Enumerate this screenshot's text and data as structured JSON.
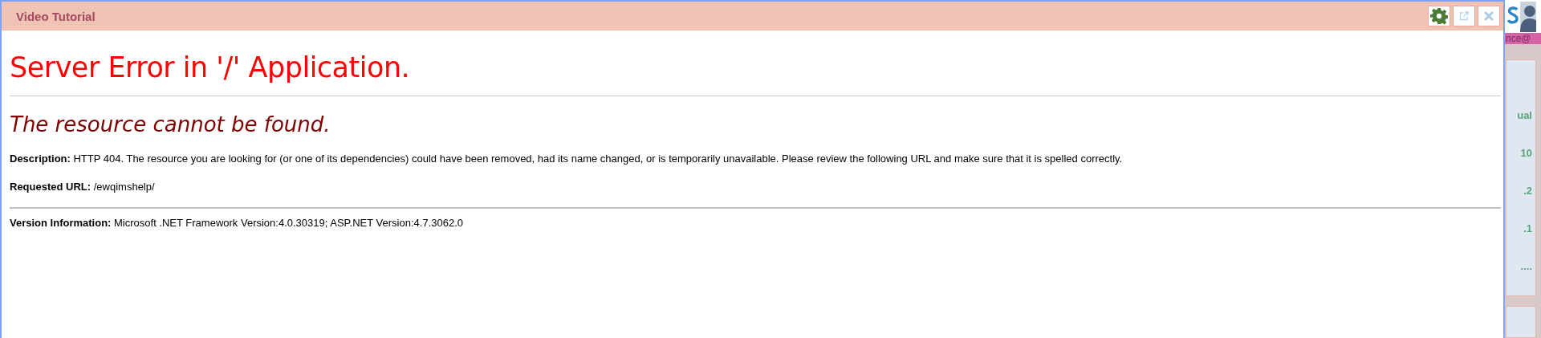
{
  "dialog": {
    "title": "Video Tutorial"
  },
  "error_page": {
    "heading": "Server Error in '/' Application.",
    "subheading": "The resource cannot be found.",
    "description": "**Description:** HTTP 404. The resource you are looking for (or one of its dependencies) could have been removed, had its name changed, or is temporarily unavailable.  Please review the following URL and make sure that it is spelled correctly.",
    "requested_url": "**Requested URL:** /ewqimshelp/",
    "version": "**Version Information:** Microsoft .NET Framework Version:4.0.30319; ASP.NET Version:4.7.3062.0"
  },
  "background_app": {
    "banner": "nce@",
    "list_items": [
      "ual",
      "10",
      ".2",
      ".1",
      "...."
    ]
  }
}
